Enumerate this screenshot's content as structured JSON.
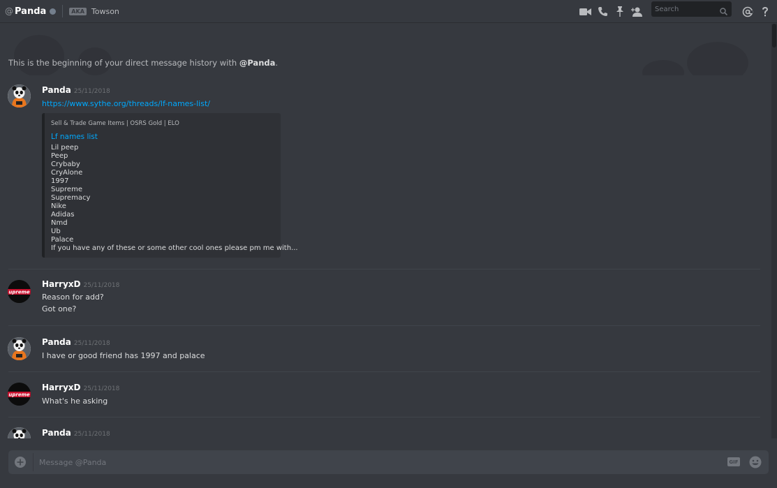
{
  "header": {
    "at_symbol": "@",
    "username": "Panda",
    "aka_badge": "AKA",
    "aka_name": "Towson",
    "search_placeholder": "Search",
    "icons": [
      "video-call-icon",
      "voice-call-icon",
      "pin-icon",
      "add-friend-icon",
      "search-icon",
      "mention-icon",
      "help-icon"
    ]
  },
  "intro": {
    "text": "This is the beginning of your direct message history with ",
    "mention": "@Panda",
    "end": "."
  },
  "messages": [
    {
      "author": "Panda",
      "timestamp": "25/11/2018",
      "avatar": "panda-avatar",
      "lines": [
        "https://www.sythe.org/threads/lf-names-list/"
      ],
      "embed": {
        "provider": "Sell & Trade Game Items | OSRS Gold | ELO",
        "title": "Lf names list",
        "description": "Lil peep\nPeep\nCrybaby\nCryAlone\n1997\nSupreme\nSupremacy\nNike\nAdidas\nNmd\nUb\nPalace\nIf you have any of these or some other cool ones please pm me with..."
      }
    },
    {
      "author": "HarryxD",
      "timestamp": "25/11/2018",
      "avatar": "supreme-avatar",
      "lines": [
        "Reason for add?",
        "Got one?"
      ]
    },
    {
      "author": "Panda",
      "timestamp": "25/11/2018",
      "avatar": "panda-avatar",
      "lines": [
        "I have or good friend has 1997 and palace"
      ]
    },
    {
      "author": "HarryxD",
      "timestamp": "25/11/2018",
      "avatar": "supreme-avatar",
      "lines": [
        "What's he asking"
      ]
    },
    {
      "author": "Panda",
      "timestamp": "25/11/2018",
      "avatar": "panda-avatar",
      "lines": []
    }
  ],
  "composer": {
    "placeholder": "Message @Panda",
    "gif_label": "GIF"
  },
  "colors": {
    "background": "#36393f",
    "link": "#00a8fc",
    "input": "#40444b"
  }
}
